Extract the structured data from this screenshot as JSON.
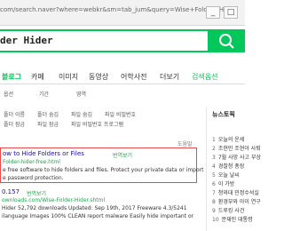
{
  "browser": {
    "url": "com/search.naver?where=webkr&sm=tab_jum&query=Wise+Folder+Hider",
    "minimize": "_",
    "maximize": "□"
  },
  "search": {
    "query": "der Hider"
  },
  "nav": {
    "items": [
      "블로그",
      "카페",
      "이미지",
      "동영상",
      "어학사전",
      "더보기"
    ],
    "active_index": 0,
    "advanced": "검색옵션"
  },
  "subfilter": {
    "row1": [
      "옵션",
      "기간",
      "영역"
    ],
    "row2": [
      "폴더 이름",
      "폴더 숨김",
      "파일 숨김",
      "파일 비밀번호"
    ],
    "row3": [
      "폴더 잠금",
      "파일 잠금",
      "파일 비밀번호 프로그램"
    ]
  },
  "related": {
    "label": "도움말"
  },
  "results": [
    {
      "title": "ow to Hide Folders or Files",
      "badge": "번역보기",
      "site": "Folder-hider-free.html",
      "desc1": "e free software to hide folders and files. Protect your private data or import",
      "desc2": "e password protection."
    },
    {
      "title": "0.157",
      "badge": "번역보기",
      "site": "ownloads.com/Wise-Folder-Hider.shtml",
      "desc1": "Hider 52,792 downloads Updated: Sep 19th, 2017 Freeware 4.3/5241",
      "desc2": "ilanguage Images 100% CLEAN report malware Easily hide important or"
    }
  ],
  "sidebar": {
    "title": "뉴스토픽",
    "items": [
      "오늘의 운세",
      "조현민 조현아 사퇴",
      "7월 사망 사고 부상",
      "경찰청 총장",
      "오늘 날씨",
      "이 가방",
      "청와대 민정수석실",
      "환경부와 아이 연구",
      "드루킹 사건",
      "문재인 대통령"
    ]
  }
}
